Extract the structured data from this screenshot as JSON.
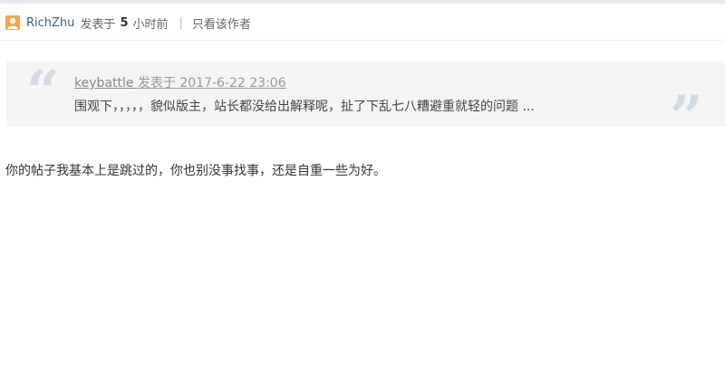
{
  "post": {
    "author": "RichZhu",
    "posted_prefix": "发表于",
    "time_value": "5",
    "time_unit": "小时前",
    "separator": "|",
    "only_author_label": "只看该作者"
  },
  "quote": {
    "user": "keybattle",
    "posted_text": "发表于 2017-6-22 23:06",
    "content": "围观下，，，，，貌似版主，站长都没给出解释呢，扯了下乱七八糟避重就轻的问题 ...",
    "open_mark": "“",
    "close_mark": "”"
  },
  "reply": {
    "content": "你的帖子我基本上是跳过的，你也别没事找事，还是自重一些为好。"
  },
  "colors": {
    "author_link": "#335f8d",
    "quote_bg": "#f4f4f4",
    "quote_mark": "#d1dbe5",
    "avatar": "#f0a94a"
  },
  "icons": {
    "avatar": "user-avatar-icon"
  }
}
